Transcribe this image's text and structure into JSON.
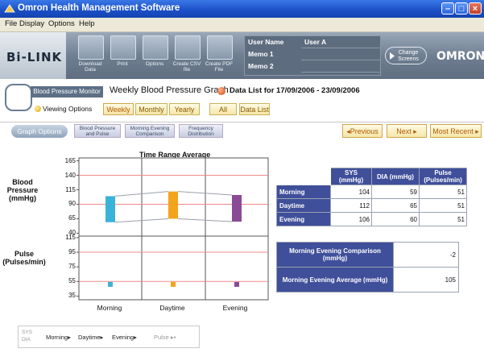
{
  "window": {
    "title": "Omron Health Management Software"
  },
  "menu": [
    "File",
    "Display",
    "Options",
    "Help"
  ],
  "toolbar": {
    "logo": "Bi-LINK",
    "buttons": [
      {
        "label": "Download Data",
        "icon": "download-icon"
      },
      {
        "label": "Print",
        "icon": "print-icon"
      },
      {
        "label": "Options",
        "icon": "options-icon"
      },
      {
        "label": "Create CSV file",
        "icon": "csv-icon"
      },
      {
        "label": "Create PDF File",
        "icon": "pdf-icon"
      }
    ],
    "user_panel": {
      "user_name_label": "User Name",
      "user_name": "User A",
      "memo1_label": "Memo 1",
      "memo1": "",
      "memo2_label": "Memo 2",
      "memo2": ""
    },
    "change_screens": "Change Screens",
    "brand": "OMRON"
  },
  "header": {
    "monitor_tag": "Blood Pressure Monitor",
    "graph_title": "Weekly Blood Pressure Graph",
    "data_list_label": "Data List for 17/09/2006 - 23/09/2006",
    "viewing_options": "Viewing Options",
    "tabs": [
      {
        "label": "Weekly",
        "selected": true
      },
      {
        "label": "Monthly",
        "selected": false
      },
      {
        "label": "Yearly",
        "selected": false
      },
      {
        "label": "All",
        "selected": false
      },
      {
        "label": "Data List",
        "selected": false
      }
    ]
  },
  "graph_options": {
    "label": "Graph Options",
    "buttons": [
      "Blood Pressure and Pulse",
      "Morning Evening Comparison",
      "Frequency Distribution"
    ],
    "nav": {
      "previous": "◂Previous",
      "next": "Next ▸",
      "recent": "Most Recent ▸"
    }
  },
  "chart_data": [
    {
      "type": "bar",
      "title": "Time Range Average",
      "ylabel": "Blood Pressure (mmHg)",
      "yticks": [
        165,
        140,
        115,
        90,
        65,
        40
      ],
      "ylim": [
        35,
        170
      ],
      "reference_lines": [
        140,
        90
      ],
      "categories": [
        "Morning",
        "Daytime",
        "Evening"
      ],
      "series": [
        {
          "name": "SYS",
          "values": [
            104,
            112,
            106
          ]
        },
        {
          "name": "DIA",
          "values": [
            59,
            65,
            60
          ]
        }
      ],
      "colors": [
        "#3bb3d6",
        "#f2a51a",
        "#8b4a96"
      ]
    },
    {
      "type": "scatter",
      "ylabel": "Pulse (Pulses/min)",
      "yticks": [
        115,
        95,
        75,
        55,
        35
      ],
      "ylim": [
        30,
        117
      ],
      "reference_lines": [
        95,
        55
      ],
      "categories": [
        "Morning",
        "Daytime",
        "Evening"
      ],
      "series": [
        {
          "name": "Pulse",
          "values": [
            51,
            51,
            51
          ]
        }
      ],
      "colors": [
        "#3bb3d6",
        "#f2a51a",
        "#8b4a96"
      ]
    }
  ],
  "value_table": {
    "headers": [
      "SYS (mmHg)",
      "DIA (mmHg)",
      "Pulse (Pulses/min)"
    ],
    "rows": [
      {
        "label": "Morning",
        "values": [
          "104",
          "59",
          "51"
        ]
      },
      {
        "label": "Daytime",
        "values": [
          "112",
          "65",
          "51"
        ]
      },
      {
        "label": "Evening",
        "values": [
          "106",
          "60",
          "51"
        ]
      }
    ]
  },
  "comparison_table": [
    {
      "label": "Morning Evening Comparison (mmHg)",
      "value": "-2"
    },
    {
      "label": "Morning Evening Average (mmHg)",
      "value": "105"
    }
  ],
  "legend": {
    "sys_dia": "SYS DIA",
    "items": [
      "Morning▸",
      "Daytime▸",
      "Evening▸",
      "Pulse ▸▪"
    ]
  }
}
